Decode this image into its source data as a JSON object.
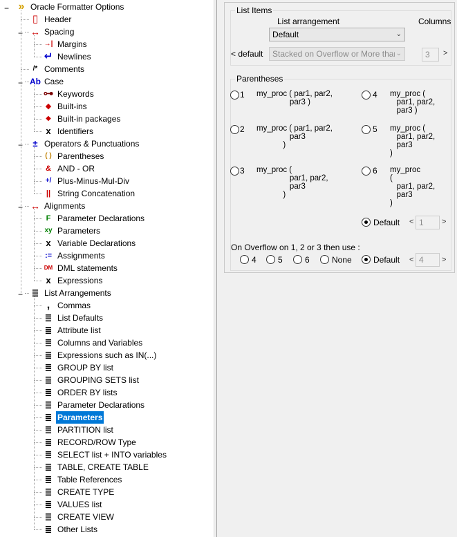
{
  "tree": [
    {
      "label": "Oracle Formatter Options",
      "level": 0,
      "icon": "chevrons-icon",
      "expander": "minus"
    },
    {
      "label": "Header",
      "level": 1,
      "icon": "document-icon"
    },
    {
      "label": "Spacing",
      "level": 1,
      "icon": "double-arrow-icon",
      "expander": "minus"
    },
    {
      "label": "Margins",
      "level": 2,
      "icon": "margin-arrow-icon"
    },
    {
      "label": "Newlines",
      "level": 2,
      "icon": "return-arrow-icon"
    },
    {
      "label": "Comments",
      "level": 1,
      "icon": "comment-icon"
    },
    {
      "label": "Case",
      "level": 1,
      "icon": "case-icon",
      "expander": "minus"
    },
    {
      "label": "Keywords",
      "level": 2,
      "icon": "key-icon"
    },
    {
      "label": "Built-ins",
      "level": 2,
      "icon": "builtin-icon"
    },
    {
      "label": "Built-in packages",
      "level": 2,
      "icon": "builtin-package-icon"
    },
    {
      "label": "Identifiers",
      "level": 2,
      "icon": "variable-x-icon"
    },
    {
      "label": "Operators & Punctuations",
      "level": 1,
      "icon": "operators-icon",
      "expander": "minus"
    },
    {
      "label": "Parentheses",
      "level": 2,
      "icon": "parentheses-icon"
    },
    {
      "label": "AND - OR",
      "level": 2,
      "icon": "and-or-icon"
    },
    {
      "label": "Plus-Minus-Mul-Div",
      "level": 2,
      "icon": "arithmetic-icon"
    },
    {
      "label": "String Concatenation",
      "level": 2,
      "icon": "concat-icon"
    },
    {
      "label": "Alignments",
      "level": 1,
      "icon": "double-arrow-icon",
      "expander": "minus"
    },
    {
      "label": "Parameter Declarations",
      "level": 2,
      "icon": "function-icon"
    },
    {
      "label": "Parameters",
      "level": 2,
      "icon": "params-icon"
    },
    {
      "label": "Variable Declarations",
      "level": 2,
      "icon": "variable-x-icon"
    },
    {
      "label": "Assignments",
      "level": 2,
      "icon": "assign-icon"
    },
    {
      "label": "DML statements",
      "level": 2,
      "icon": "dml-icon"
    },
    {
      "label": "Expressions",
      "level": 2,
      "icon": "variable-x-icon"
    },
    {
      "label": "List Arrangements",
      "level": 1,
      "icon": "list-icon",
      "expander": "minus"
    },
    {
      "label": "Commas",
      "level": 2,
      "icon": "comma-icon"
    },
    {
      "label": "List Defaults",
      "level": 2,
      "icon": "list-icon"
    },
    {
      "label": "Attribute list",
      "level": 2,
      "icon": "list-icon"
    },
    {
      "label": "Columns and Variables",
      "level": 2,
      "icon": "list-icon"
    },
    {
      "label": "Expressions such as IN(...)",
      "level": 2,
      "icon": "list-icon"
    },
    {
      "label": "GROUP BY list",
      "level": 2,
      "icon": "list-icon"
    },
    {
      "label": "GROUPING SETS list",
      "level": 2,
      "icon": "list-icon"
    },
    {
      "label": "ORDER BY lists",
      "level": 2,
      "icon": "list-icon"
    },
    {
      "label": "Parameter Declarations",
      "level": 2,
      "icon": "list-icon"
    },
    {
      "label": "Parameters",
      "level": 2,
      "icon": "list-icon",
      "selected": true
    },
    {
      "label": "PARTITION list",
      "level": 2,
      "icon": "list-icon"
    },
    {
      "label": "RECORD/ROW Type",
      "level": 2,
      "icon": "list-icon"
    },
    {
      "label": "SELECT list + INTO variables",
      "level": 2,
      "icon": "list-icon"
    },
    {
      "label": "TABLE, CREATE TABLE",
      "level": 2,
      "icon": "list-icon"
    },
    {
      "label": "Table References",
      "level": 2,
      "icon": "list-icon"
    },
    {
      "label": "CREATE TYPE",
      "level": 2,
      "icon": "list-icon"
    },
    {
      "label": "VALUES list",
      "level": 2,
      "icon": "list-icon"
    },
    {
      "label": "CREATE VIEW",
      "level": 2,
      "icon": "list-icon"
    },
    {
      "label": "Other Lists",
      "level": 2,
      "icon": "list-icon"
    }
  ],
  "list_items": {
    "title": "List Items",
    "arrangement_label": "List arrangement",
    "columns_label": "Columns",
    "arrangement_value": "Default",
    "default_link": "< default",
    "stacked_value": "Stacked on Overflow or More than ...",
    "columns_value": "3",
    "next": ">"
  },
  "parentheses": {
    "title": "Parentheses",
    "options": [
      {
        "num": "1",
        "code": "my_proc ( par1, par2,\n               par3 )",
        "selected": false
      },
      {
        "num": "2",
        "code": "my_proc ( par1, par2,\n               par3\n            )",
        "selected": false
      },
      {
        "num": "3",
        "code": "my_proc (\n               par1, par2,\n               par3\n            )",
        "selected": false
      },
      {
        "num": "4",
        "code": "my_proc (\n   par1, par2,\n   par3 )",
        "selected": false
      },
      {
        "num": "5",
        "code": "my_proc (\n   par1, par2,\n   par3\n)",
        "selected": false
      },
      {
        "num": "6",
        "code": "my_proc\n(\n   par1, par2,\n   par3\n)",
        "selected": false
      }
    ],
    "default_label": "Default",
    "default_selected": true,
    "default_value": "1",
    "prev": "<",
    "next": ">"
  },
  "overflow": {
    "label": "On Overflow on 1, 2 or 3 then use :",
    "options": [
      {
        "label": "4",
        "selected": false
      },
      {
        "label": "5",
        "selected": false
      },
      {
        "label": "6",
        "selected": false
      },
      {
        "label": "None",
        "selected": false
      },
      {
        "label": "Default",
        "selected": true
      }
    ],
    "default_value": "4",
    "prev": "<",
    "next": ">"
  },
  "colors": {
    "selection": "#0078d7",
    "accent_red": "#cc0000",
    "accent_blue": "#0000cc"
  }
}
